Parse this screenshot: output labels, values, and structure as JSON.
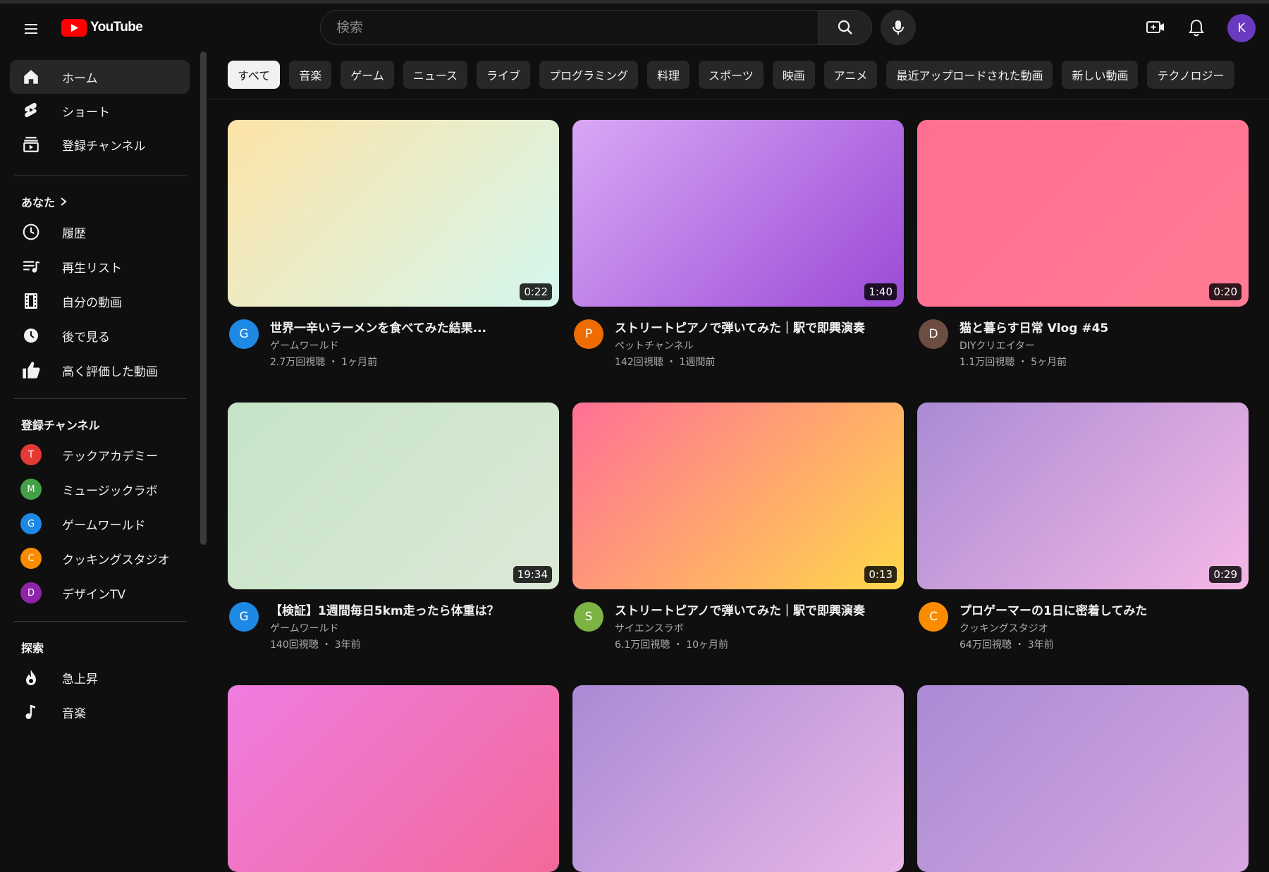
{
  "header": {
    "logo_text": "YouTube",
    "search_placeholder": "検索",
    "avatar_letter": "K"
  },
  "sidebar": {
    "main_items": [
      {
        "label": "ホーム",
        "icon": "home-icon",
        "active": true
      },
      {
        "label": "ショート",
        "icon": "shorts-icon"
      },
      {
        "label": "登録チャンネル",
        "icon": "subscriptions-icon"
      }
    ],
    "you_section": {
      "title": "あなた",
      "items": [
        {
          "label": "履歴",
          "icon": "history-icon"
        },
        {
          "label": "再生リスト",
          "icon": "playlist-icon"
        },
        {
          "label": "自分の動画",
          "icon": "my-videos-icon"
        },
        {
          "label": "後で見る",
          "icon": "watch-later-icon"
        },
        {
          "label": "高く評価した動画",
          "icon": "like-icon"
        }
      ]
    },
    "subs_section": {
      "title": "登録チャンネル",
      "channels": [
        {
          "label": "テックアカデミー",
          "letter": "T",
          "color": "#e53935"
        },
        {
          "label": "ミュージックラボ",
          "letter": "M",
          "color": "#43a047"
        },
        {
          "label": "ゲームワールド",
          "letter": "G",
          "color": "#1e88e5"
        },
        {
          "label": "クッキングスタジオ",
          "letter": "C",
          "color": "#fb8c00"
        },
        {
          "label": "デザインTV",
          "letter": "D",
          "color": "#8e24aa"
        }
      ]
    },
    "explore_section": {
      "title": "探索",
      "items": [
        {
          "label": "急上昇",
          "icon": "trending-icon"
        },
        {
          "label": "音楽",
          "icon": "music-icon"
        }
      ]
    }
  },
  "chips": [
    "すべて",
    "音楽",
    "ゲーム",
    "ニュース",
    "ライブ",
    "プログラミング",
    "料理",
    "スポーツ",
    "映画",
    "アニメ",
    "最近アップロードされた動画",
    "新しい動画",
    "テクノロジー"
  ],
  "videos": [
    {
      "title": "世界一辛いラーメンを食べてみた結果...",
      "channel": "ゲームワールド",
      "views": "2.7万回視聴",
      "age": "1ヶ月前",
      "duration": "0:22",
      "avatar_letter": "G",
      "avatar_color": "#1e88e5",
      "thumb_from": "#fde3a7",
      "thumb_to": "#d4f7ef"
    },
    {
      "title": "ストリートピアノで弾いてみた｜駅で即興演奏",
      "channel": "ペットチャンネル",
      "views": "142回視聴",
      "age": "1週間前",
      "duration": "1:40",
      "avatar_letter": "P",
      "avatar_color": "#ef6c00",
      "thumb_from": "#d9a7f5",
      "thumb_to": "#9b4ad6"
    },
    {
      "title": "猫と暮らす日常 Vlog #45",
      "channel": "DIYクリエイター",
      "views": "1.1万回視聴",
      "age": "5ヶ月前",
      "duration": "0:20",
      "avatar_letter": "D",
      "avatar_color": "#6d4c41",
      "thumb_from": "#ff6f91",
      "thumb_to": "#ff7a92"
    },
    {
      "title": "【検証】1週間毎日5km走ったら体重は？",
      "channel": "ゲームワールド",
      "views": "140回視聴",
      "age": "3年前",
      "duration": "19:34",
      "avatar_letter": "G",
      "avatar_color": "#1e88e5",
      "thumb_from": "#c6e3c7",
      "thumb_to": "#dbe9d6"
    },
    {
      "title": "ストリートピアノで弾いてみた｜駅で即興演奏",
      "channel": "サイエンスラボ",
      "views": "6.1万回視聴",
      "age": "10ヶ月前",
      "duration": "0:13",
      "avatar_letter": "S",
      "avatar_color": "#7cb342",
      "thumb_from": "#ff7096",
      "thumb_to": "#ffd84a"
    },
    {
      "title": "プロゲーマーの1日に密着してみた",
      "channel": "クッキングスタジオ",
      "views": "64万回視聴",
      "age": "3年前",
      "duration": "0:29",
      "avatar_letter": "C",
      "avatar_color": "#fb8c00",
      "thumb_from": "#a98bd4",
      "thumb_to": "#f5b8e6"
    },
    {
      "thumb_from": "#f07ce0",
      "thumb_to": "#f26a9a"
    },
    {
      "thumb_from": "#a98bd4",
      "thumb_to": "#e9b6e8"
    },
    {
      "thumb_from": "#a98bd4",
      "thumb_to": "#d8a8e0"
    }
  ]
}
